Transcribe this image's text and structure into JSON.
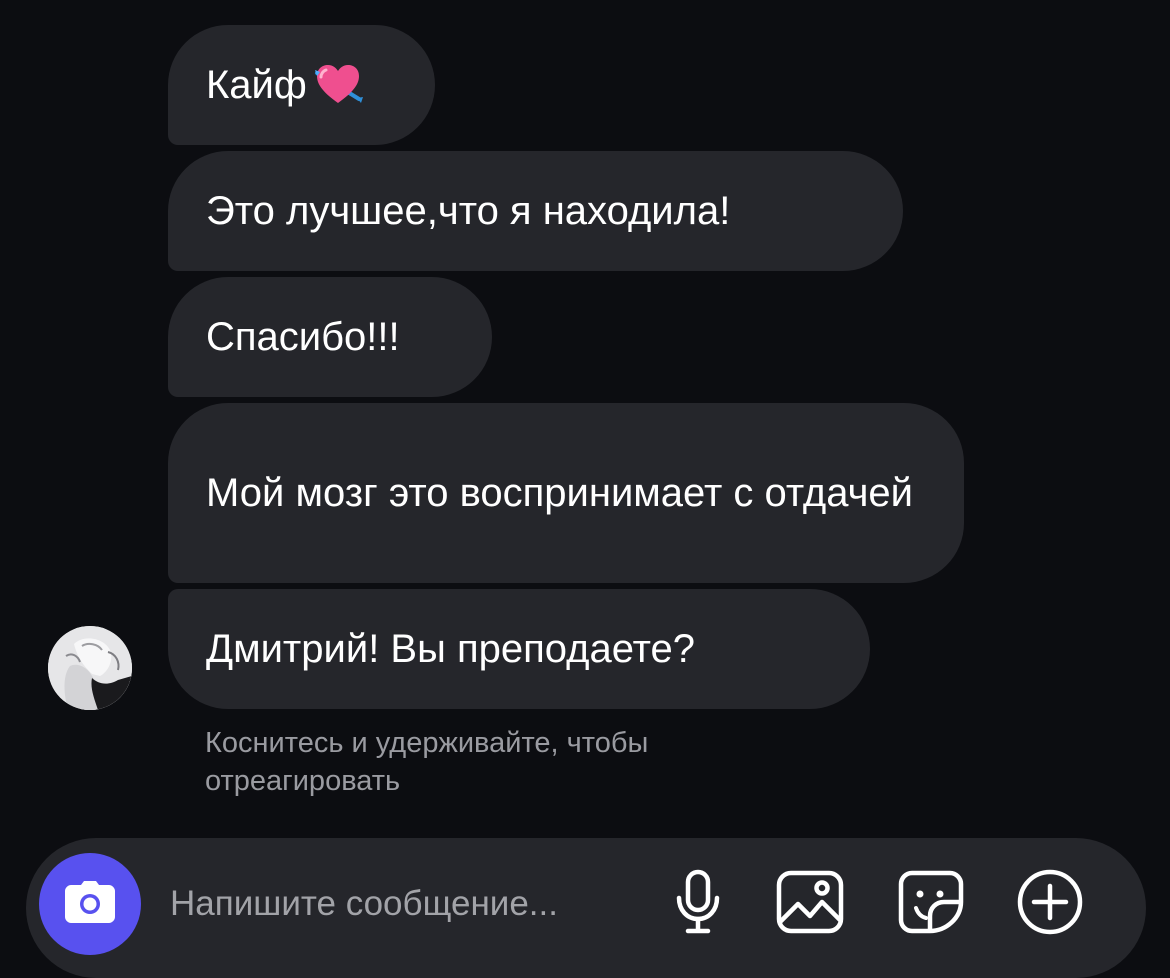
{
  "messages": [
    {
      "text": "Кайф",
      "emoji": "heart-with-arrow"
    },
    {
      "text": "Это лучшее,что я находила!"
    },
    {
      "text": "Спасибо!!!"
    },
    {
      "text": "Мой мозг это воспринимает с отдачей"
    },
    {
      "text": "Дмитрий! Вы преподаете?"
    }
  ],
  "hint": "Коснитесь и удерживайте, чтобы отреагировать",
  "composer": {
    "placeholder": "Напишите сообщение...",
    "icons": [
      "camera-icon",
      "microphone-icon",
      "image-icon",
      "sticker-icon",
      "plus-circle-icon"
    ]
  },
  "colors": {
    "background": "#0c0d11",
    "bubble": "#25262b",
    "accent": "#5851ef",
    "hint_text": "#9a9ba1"
  }
}
